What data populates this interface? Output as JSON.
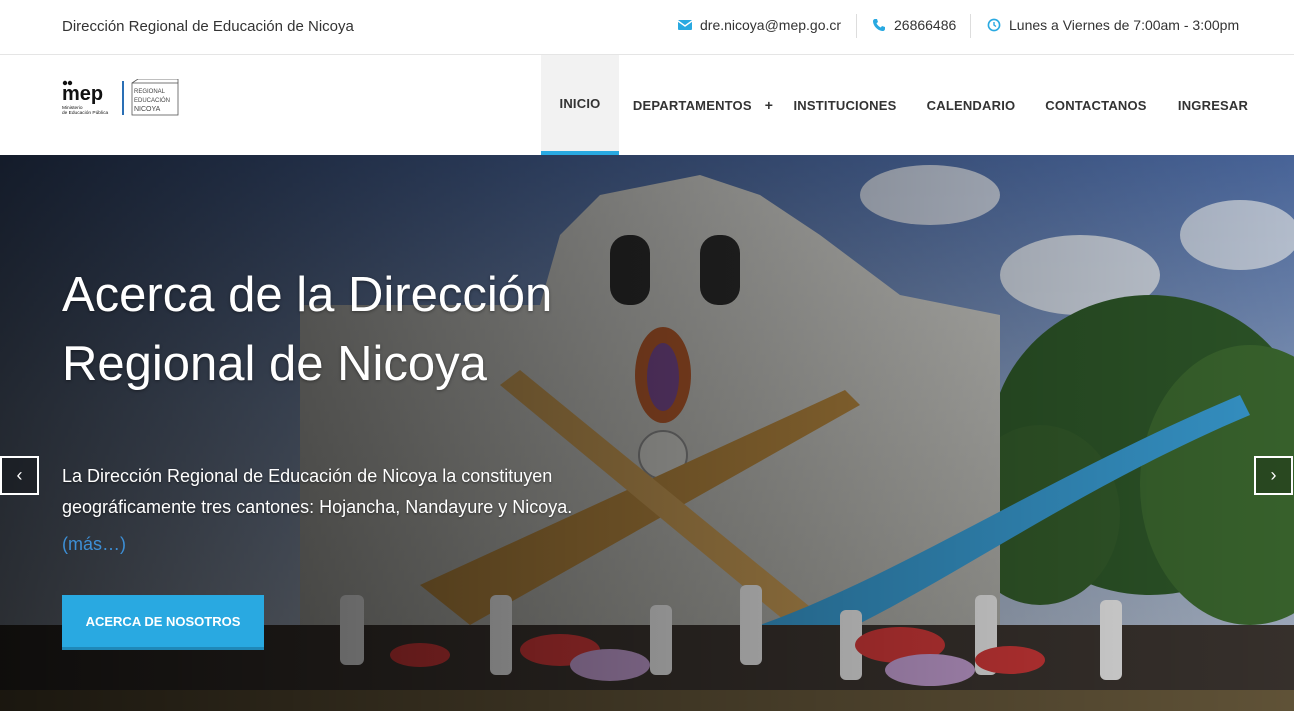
{
  "topbar": {
    "org_name": "Dirección Regional de Educación de Nicoya",
    "email": "dre.nicoya@mep.go.cr",
    "phone": "26866486",
    "hours": "Lunes a Viernes de 7:00am - 3:00pm",
    "icons": {
      "email": "envelope-icon",
      "phone": "phone-icon",
      "hours": "clock-icon"
    }
  },
  "logo": {
    "mep_text": "mep",
    "mep_sub": "Ministerio de Educación Pública",
    "regional_text": "DIRECCIÓN REGIONAL DE EDUCACIÓN NICOYA"
  },
  "nav": {
    "items": [
      {
        "label": "INICIO",
        "active": true
      },
      {
        "label": "DEPARTAMENTOS",
        "has_submenu": true,
        "submenu_icon": "+"
      },
      {
        "label": "INSTITUCIONES"
      },
      {
        "label": "CALENDARIO"
      },
      {
        "label": "CONTACTANOS"
      },
      {
        "label": "INGRESAR"
      }
    ]
  },
  "hero": {
    "title": "Acerca de la Dirección Regional de Nicoya",
    "description": "La Dirección Regional de Educación de Nicoya la constituyen geográficamente tres cantones: Hojancha, Nandayure y Nicoya.",
    "more_link": "(más…)",
    "button_label": "ACERCA DE NOSOTROS",
    "prev_arrow": "‹",
    "next_arrow": "›"
  },
  "colors": {
    "accent": "#29a9e1",
    "link": "#3d8fd6",
    "text": "#333333"
  }
}
